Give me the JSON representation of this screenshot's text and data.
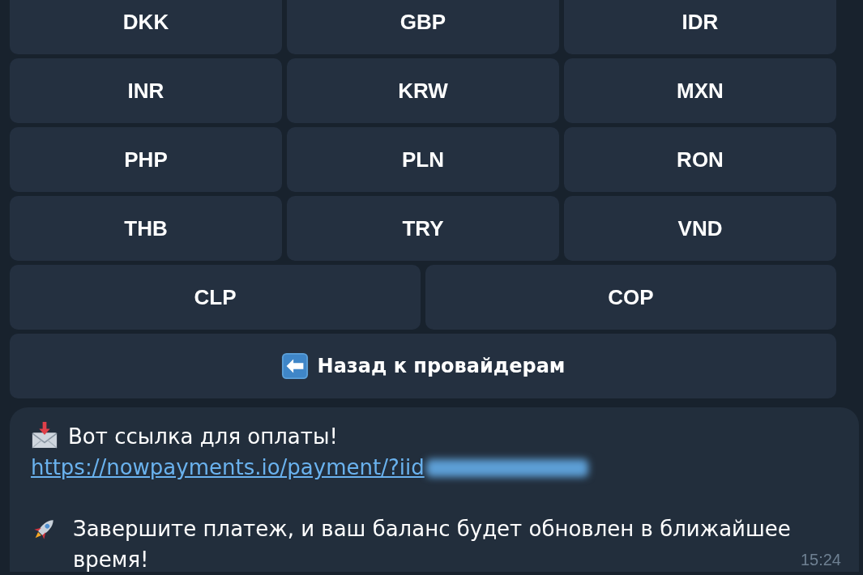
{
  "keyboard": {
    "rows": [
      [
        "DKK",
        "GBP",
        "IDR"
      ],
      [
        "INR",
        "KRW",
        "MXN"
      ],
      [
        "PHP",
        "PLN",
        "RON"
      ],
      [
        "THB",
        "TRY",
        "VND"
      ],
      [
        "CLP",
        "COP"
      ]
    ],
    "back_button": {
      "label": "Назад к провайдерам"
    }
  },
  "message": {
    "title": "Вот ссылка для оплаты!",
    "link": "https://nowpayments.io/payment/?iid",
    "note": "Завершите платеж, и ваш баланс будет обновлен в ближайшее время!",
    "time": "15:24"
  }
}
